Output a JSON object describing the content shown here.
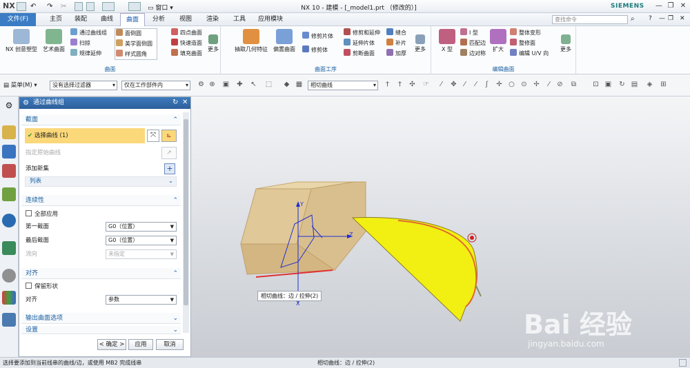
{
  "titlebar": {
    "logo": "NX",
    "window_menu": "窗口",
    "title": "NX 10 - 建模 - [_model1.prt （修改的）]",
    "brand": "SIEMENS"
  },
  "menubar": {
    "file": "文件(F)",
    "tabs": [
      "主页",
      "装配",
      "曲线",
      "曲面",
      "分析",
      "视图",
      "渲染",
      "工具",
      "应用模块"
    ],
    "active_tab": "曲面",
    "search_placeholder": "查找命令"
  },
  "ribbon": {
    "group1": {
      "label": "曲面",
      "big": [
        "NX 创意塑型",
        "艺术曲面"
      ],
      "small": [
        "通过曲线组",
        "扫掠",
        "规律延伸",
        "面倒圆",
        "美学面倒圆",
        "样式圆角",
        "四点曲面",
        "快速造面",
        "填充曲面"
      ],
      "more": "更多"
    },
    "group2": {
      "label": "曲面工序",
      "big": [
        "抽取几何特征",
        "偏置曲面"
      ],
      "small": [
        "修剪片体",
        "修剪体",
        "修剪和延伸",
        "延伸片体",
        "剪断曲面",
        "缝合",
        "补片",
        "加厚"
      ],
      "more": "更多"
    },
    "group3": {
      "label": "编辑曲面",
      "big": [
        "X 型",
        "扩大"
      ],
      "small": [
        "I 型",
        "匹配边",
        "边对称",
        "整体变形",
        "整修面",
        "编辑 U/V 向"
      ],
      "more": "更多"
    }
  },
  "toolbar": {
    "menu": "菜单(M)",
    "filter": "没有选择过滤器",
    "scope": "仅在工作部件内",
    "curve_rule": "相切曲线"
  },
  "dialog": {
    "title": "通过曲线组",
    "section_label": "截面",
    "select_curve": "选择曲线 (1)",
    "specify_origin": "指定原始曲线",
    "add_new_set": "添加新集",
    "list": "列表",
    "continuity_label": "连续性",
    "apply_all": "全部应用",
    "first_section": "第一截面",
    "first_value": "G0（位置）",
    "last_section": "最后截面",
    "last_value": "G0（位置）",
    "flow": "流向",
    "flow_value": "未指定",
    "align_label": "对齐",
    "keep_shape": "保留形状",
    "align": "对齐",
    "align_value": "参数",
    "output_label": "输出曲面选项",
    "settings_label": "设置",
    "ok": "< 确定 >",
    "apply": "应用",
    "cancel": "取消"
  },
  "viewport": {
    "axis_y": "Y",
    "axis_z": "Z",
    "axis_x": "X",
    "tooltip": "相切曲线：边 / 拉伸(2)",
    "watermark": "Bai 经验",
    "watermark_url": "jingyan.baidu.com"
  },
  "status": {
    "left": "选择要添加到当前线串的曲线/边，或使用 MB2 完成线串",
    "center": "相切曲线：边 / 拉伸(2)"
  },
  "colors": {
    "accent": "#3b7cc4",
    "selection": "#fbd87a",
    "surface": "#f2f012",
    "box": "#e8d3a6"
  }
}
